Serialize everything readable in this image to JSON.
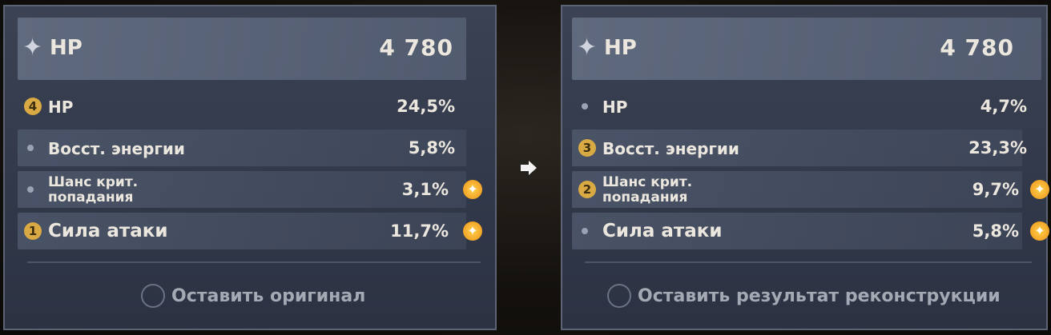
{
  "left": {
    "main": {
      "name": "HP",
      "value": "4 780"
    },
    "subs": [
      {
        "badge": "4",
        "name": "HP",
        "value": "24,5%",
        "plus": false
      },
      {
        "badge": "",
        "name": "Восст. энергии",
        "value": "5,8%",
        "plus": false
      },
      {
        "badge": "",
        "name": "Шанс крит.\nпопадания",
        "value": "3,1%",
        "plus": true
      },
      {
        "badge": "1",
        "name": "Сила атаки",
        "value": "11,7%",
        "plus": true
      }
    ],
    "choice": "Оставить оригинал"
  },
  "right": {
    "main": {
      "name": "HP",
      "value": "4 780"
    },
    "subs": [
      {
        "badge": "",
        "name": "HP",
        "value": "4,7%",
        "plus": false
      },
      {
        "badge": "3",
        "name": "Восст. энергии",
        "value": "23,3%",
        "plus": false
      },
      {
        "badge": "2",
        "name": "Шанс крит.\nпопадания",
        "value": "9,7%",
        "plus": true
      },
      {
        "badge": "",
        "name": "Сила атаки",
        "value": "5,8%",
        "plus": true
      }
    ],
    "choice": "Оставить результат реконструкции"
  },
  "colors": {
    "badge": "#d9a943",
    "plus": "#f2a528",
    "panel": "#343b4c"
  }
}
